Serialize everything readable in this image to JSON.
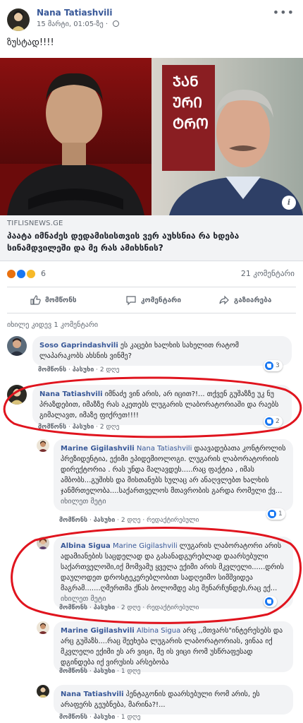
{
  "post": {
    "author": "Nana Tatiashvili",
    "time": "15 მარტი, 01:05-ზე · ",
    "text": "ზუსტად!!!!"
  },
  "link": {
    "domain": "TIFLISNEWS.GE",
    "title": "პაატა იმნაძეს დედამისისთვის ვერ აუხსნია რა ხდება სინამდვილეში და მე რას ამიხსნის?"
  },
  "stats": {
    "reaction_count": "6",
    "comment_count": "21 კომენტარი"
  },
  "actions": {
    "like": "მომწონს",
    "comment": "კომენტარი",
    "share": "გაზიარება"
  },
  "view_previous": "იხილე კიდევ 1 კომენტარი",
  "comments": [
    {
      "name": "Soso Gaprindashvili",
      "text": " ეს კაცები ხალხის სახელით რატომ ლაპარაკობს ახსნის ვინმე?",
      "like_label": "მომწონს",
      "reply_label": "პასუხი",
      "time": "2 დღე",
      "likes": "3"
    },
    {
      "name": "Nana Tatiashvili",
      "text": " იმნაძე ვინ არის, არ იცით?!... თქვენ გუშაზზე უკ ნუ პრაზდებით, იმაზზე რას აკეთებს ლუგარის ლაბორატორიაში და რაებს გიმალავთ, იმაზე ფიქრეთ!!!!",
      "like_label": "მომწონს",
      "reply_label": "პასუხი",
      "time": "2 დღე",
      "likes": "2"
    },
    {
      "name": "Marine Gigilashvili",
      "mention": " Nana Tatiashvili",
      "text": " დაავადებათა კონტროლის პრეზიდენტია, ექიმი ეპიდემიოლოგი. ლუგარის ლაბორატორიის დირექტორია . რას უნდა მალავდეს.....რაც ფაქტია , იმას ამბობს...გუშიხს და მისთანებს სულაც არ ანაღვლებთ ხალხის ჯანმრთელობა....საქართველოს მთავრობის გარდა რომელი ქვ...",
      "see_more": " იხილეთ მეტი",
      "like_label": "მომწონს",
      "reply_label": "პასუხი",
      "time": "2 დღე",
      "edited": "რედაქტირებული",
      "likes": "1"
    },
    {
      "name": "Albina Sigua",
      "mention": " Marine Gigilashvili",
      "text": " ლუგარის ლაბორატორი არის ადამიანების საცდელად და გასანადგურებლად დაარსებული საქართველოში,იქ მომვამუ ყველა ექიმი არის მკვლელი......დრის დაულოდეთ დროსტეკერებლობით სადღეიმო სიმშვიდეა მაგრამ.......ღმერთმა ქნას ბოლომდე ასე შენარჩუნდეს,რაც ექ...",
      "see_more": " იხილეთ მეტი",
      "like_label": "მომწონს",
      "reply_label": "პასუხი",
      "time": "2 დღე",
      "edited": "რედაქტირებული"
    },
    {
      "name": "Marine Gigilashvili",
      "mention": " Albina Sigua",
      "text": " არც ,,მთვარს\"ინტერესებს და არც გუშაზს....რაც შეეხება ლუგარის ლაბორატორიას, ვინაა იქ მკვლელი ექიმი ეს არ ვიცი, მე ის ვიცი რომ უსწრაფესად დგინდება იქ ვირუსის არსებობა",
      "like_label": "მომწონს",
      "reply_label": "პასუხი",
      "time": "1 დღე"
    },
    {
      "name": "Nana Tatiashvili",
      "text": " პენტაგონის დაარსებული რომ არის, ეს არაფერს გეუბნება, მარინა?!...",
      "like_label": "მომწონს",
      "reply_label": "პასუხი",
      "time": "1 დღე"
    }
  ],
  "colors": {
    "link_blue": "#385898",
    "annotation_red": "#e0141e",
    "like_blue": "#1877f2",
    "bubble_gray": "#f2f3f5"
  }
}
